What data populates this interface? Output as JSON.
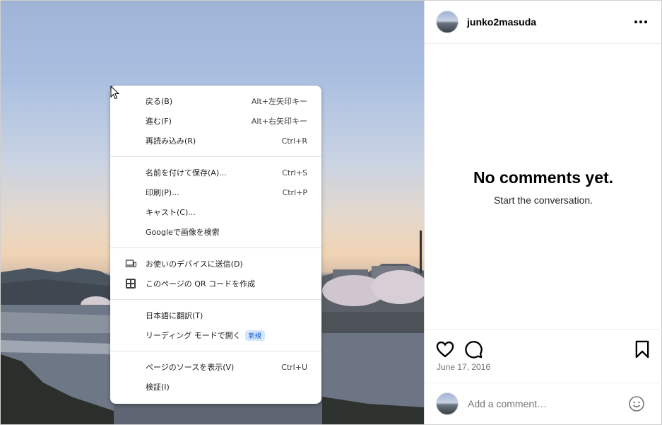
{
  "post": {
    "username": "junko2masuda",
    "more_icon": "more-horizontal-icon",
    "empty_title": "No comments yet.",
    "empty_subtitle": "Start the conversation.",
    "date": "June 17, 2016",
    "comment_placeholder": "Add a comment…",
    "actions": [
      "heart-icon",
      "comment-icon",
      "bookmark-icon"
    ],
    "emoji_icon": "emoji-icon"
  },
  "context_menu": {
    "groups": [
      [
        {
          "label": "戻る(B)",
          "shortcut": "Alt+左矢印キー"
        },
        {
          "label": "進む(F)",
          "shortcut": "Alt+右矢印キー"
        },
        {
          "label": "再読み込み(R)",
          "shortcut": "Ctrl+R"
        }
      ],
      [
        {
          "label": "名前を付けて保存(A)...",
          "shortcut": "Ctrl+S"
        },
        {
          "label": "印刷(P)...",
          "shortcut": "Ctrl+P"
        },
        {
          "label": "キャスト(C)...",
          "shortcut": ""
        },
        {
          "label": "Googleで画像を検索",
          "shortcut": ""
        }
      ],
      [
        {
          "label": "お使いのデバイスに送信(D)",
          "shortcut": "",
          "icon": "device-send-icon"
        },
        {
          "label": "このページの QR コードを作成",
          "shortcut": "",
          "icon": "qr-code-icon"
        }
      ],
      [
        {
          "label": "日本語に翻訳(T)",
          "shortcut": ""
        },
        {
          "label": "リーディング モードで開く",
          "shortcut": "",
          "badge": "新規"
        }
      ],
      [
        {
          "label": "ページのソースを表示(V)",
          "shortcut": "Ctrl+U"
        },
        {
          "label": "検証(I)",
          "shortcut": ""
        }
      ]
    ]
  },
  "colors": {
    "menu_text": "#202124",
    "separator": "#dde5ea",
    "badge_bg": "#d6e6fb",
    "badge_text": "#0b57d0",
    "date_text": "#737373"
  }
}
